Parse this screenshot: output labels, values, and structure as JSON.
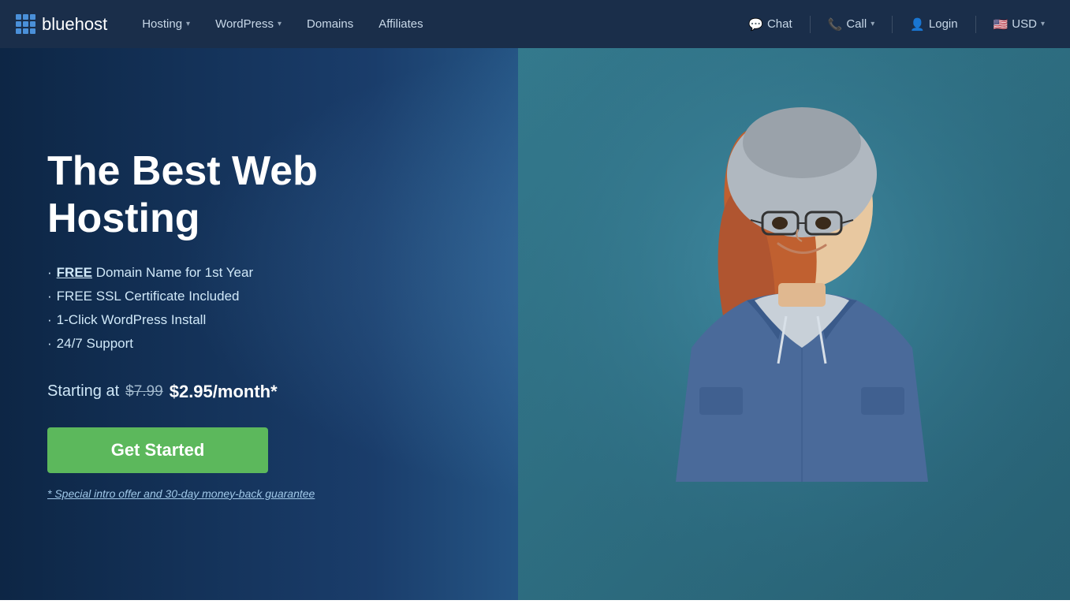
{
  "brand": {
    "name": "bluehost"
  },
  "navbar": {
    "links": [
      {
        "label": "Hosting",
        "has_dropdown": true
      },
      {
        "label": "WordPress",
        "has_dropdown": true
      },
      {
        "label": "Domains",
        "has_dropdown": false
      },
      {
        "label": "Affiliates",
        "has_dropdown": false
      }
    ],
    "right_items": [
      {
        "label": "Chat",
        "icon": "chat-icon"
      },
      {
        "label": "Call",
        "icon": "phone-icon",
        "has_dropdown": true
      },
      {
        "label": "Login",
        "icon": "user-icon"
      },
      {
        "label": "USD",
        "icon": "flag-icon",
        "has_dropdown": true
      }
    ]
  },
  "hero": {
    "title": "The Best Web Hosting",
    "features": [
      {
        "bullet": "·",
        "prefix": "",
        "bold_text": "FREE",
        "text": " Domain Name for 1st Year"
      },
      {
        "bullet": "·",
        "prefix": "",
        "bold_text": "",
        "text": "FREE SSL Certificate Included"
      },
      {
        "bullet": "·",
        "prefix": "",
        "bold_text": "",
        "text": "1-Click WordPress Install"
      },
      {
        "bullet": "·",
        "prefix": "",
        "bold_text": "",
        "text": "24/7 Support"
      }
    ],
    "pricing_label": "Starting at",
    "price_old": "$7.99",
    "price_new": "$2.95/month*",
    "cta_button": "Get Started",
    "disclaimer": "* Special intro offer and 30-day money-back guarantee"
  }
}
